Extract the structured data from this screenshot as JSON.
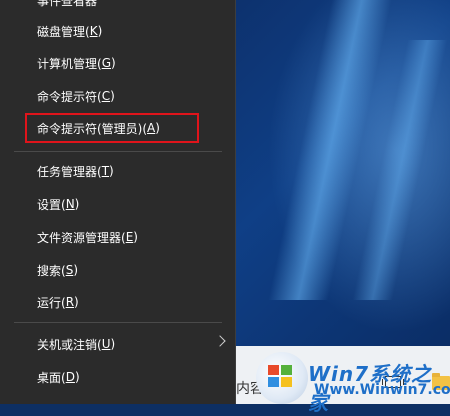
{
  "menu": {
    "items": [
      {
        "id": "top-partial",
        "label": "事件查看器",
        "key": ""
      },
      {
        "id": "disk",
        "label": "磁盘管理(",
        "key": "K",
        "end": ")"
      },
      {
        "id": "computer",
        "label": "计算机管理(",
        "key": "G",
        "end": ")"
      },
      {
        "id": "cmd",
        "label": "命令提示符(",
        "key": "C",
        "end": ")"
      },
      {
        "id": "cmd-admin",
        "label": "命令提示符(管理员)(",
        "key": "A",
        "end": ")"
      },
      {
        "id": "taskmgr",
        "label": "任务管理器(",
        "key": "T",
        "end": ")"
      },
      {
        "id": "settings",
        "label": "设置(",
        "key": "N",
        "end": ")"
      },
      {
        "id": "explorer",
        "label": "文件资源管理器(",
        "key": "E",
        "end": ")"
      },
      {
        "id": "search",
        "label": "搜索(",
        "key": "S",
        "end": ")"
      },
      {
        "id": "run",
        "label": "运行(",
        "key": "R",
        "end": ")"
      },
      {
        "id": "shutdown",
        "label": "关机或注销(",
        "key": "U",
        "end": ")"
      },
      {
        "id": "desktop",
        "label": "桌面(",
        "key": "D",
        "end": ")"
      }
    ]
  },
  "taskbar": {
    "search_text": "内容"
  },
  "watermark": {
    "line1": "Win7系统之家",
    "line2": "Www.Winwin7.com"
  },
  "colors": {
    "menu_bg": "#2b2b2b",
    "highlight": "#e0141b",
    "taskbar": "#eef1f4"
  }
}
